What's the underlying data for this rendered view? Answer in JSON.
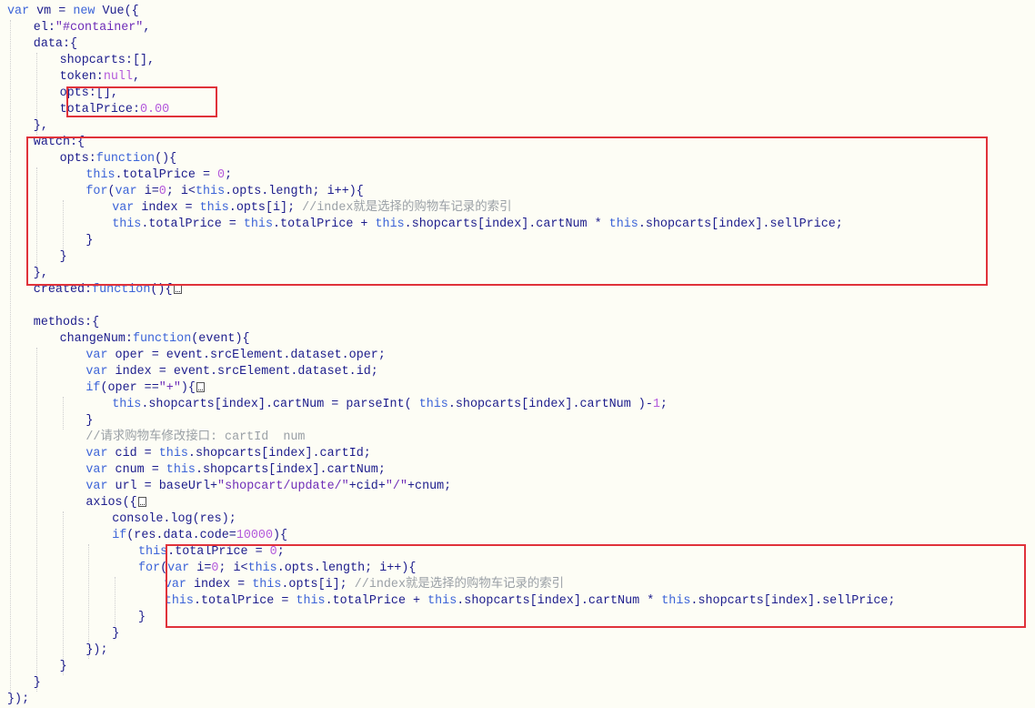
{
  "editor": {
    "lines": [
      [
        [
          "var",
          "kw"
        ],
        [
          " vm = ",
          ""
        ],
        [
          "new",
          "kw"
        ],
        [
          " Vue({",
          ""
        ]
      ],
      [
        [
          "el:",
          ""
        ],
        [
          "\"#container\"",
          "str"
        ],
        [
          ",",
          ""
        ]
      ],
      [
        [
          "data:{",
          ""
        ]
      ],
      [
        [
          "shopcarts:[],",
          ""
        ]
      ],
      [
        [
          "token:",
          ""
        ],
        [
          "null",
          "lit"
        ],
        [
          ",",
          ""
        ]
      ],
      [
        [
          "opts:[],",
          ""
        ]
      ],
      [
        [
          "totalPrice:",
          ""
        ],
        [
          "0.00",
          "lit"
        ]
      ],
      [
        [
          "},",
          ""
        ]
      ],
      [
        [
          "watch:{",
          ""
        ]
      ],
      [
        [
          "opts:",
          ""
        ],
        [
          "function",
          "kw"
        ],
        [
          "(){",
          ""
        ]
      ],
      [
        [
          "this",
          "kw"
        ],
        [
          ".totalPrice = ",
          ""
        ],
        [
          "0",
          "lit"
        ],
        [
          ";",
          ""
        ]
      ],
      [
        [
          "for",
          "kw"
        ],
        [
          "(",
          ""
        ],
        [
          "var",
          "kw"
        ],
        [
          " i=",
          ""
        ],
        [
          "0",
          "lit"
        ],
        [
          "; i<",
          ""
        ],
        [
          "this",
          "kw"
        ],
        [
          ".opts.length; i++){",
          ""
        ]
      ],
      [
        [
          "var",
          "kw"
        ],
        [
          " index = ",
          ""
        ],
        [
          "this",
          "kw"
        ],
        [
          ".opts[i]; ",
          ""
        ],
        [
          "//index就是选择的购物车记录的索引",
          "cm"
        ]
      ],
      [
        [
          "this",
          "kw"
        ],
        [
          ".totalPrice = ",
          ""
        ],
        [
          "this",
          "kw"
        ],
        [
          ".totalPrice + ",
          ""
        ],
        [
          "this",
          "kw"
        ],
        [
          ".shopcarts[index].cartNum * ",
          ""
        ],
        [
          "this",
          "kw"
        ],
        [
          ".shopcarts[index].sellPrice;",
          ""
        ]
      ],
      [
        [
          "}",
          ""
        ]
      ],
      [
        [
          "}",
          ""
        ]
      ],
      [
        [
          "},",
          ""
        ]
      ],
      [
        [
          "created:",
          ""
        ],
        [
          "function",
          "kw"
        ],
        [
          "(){",
          ""
        ],
        [
          "",
          "fold"
        ]
      ],
      [],
      [
        [
          "methods:{",
          ""
        ]
      ],
      [
        [
          "changeNum:",
          ""
        ],
        [
          "function",
          "kw"
        ],
        [
          "(event){",
          ""
        ]
      ],
      [
        [
          "var",
          "kw"
        ],
        [
          " oper = event.srcElement.dataset.oper;",
          ""
        ]
      ],
      [
        [
          "var",
          "kw"
        ],
        [
          " index = event.srcElement.dataset.id;",
          ""
        ]
      ],
      [
        [
          "if",
          "kw"
        ],
        [
          "(oper ==",
          ""
        ],
        [
          "\"+\"",
          "str"
        ],
        [
          "){",
          ""
        ],
        [
          "",
          "fold"
        ]
      ],
      [
        [
          "this",
          "kw"
        ],
        [
          ".shopcarts[index].cartNum = parseInt( ",
          ""
        ],
        [
          "this",
          "kw"
        ],
        [
          ".shopcarts[index].cartNum )-",
          ""
        ],
        [
          "1",
          "lit"
        ],
        [
          ";",
          ""
        ]
      ],
      [
        [
          "}",
          ""
        ]
      ],
      [
        [
          "//请求购物车修改接口: cartId  num",
          "cm"
        ]
      ],
      [
        [
          "var",
          "kw"
        ],
        [
          " cid = ",
          ""
        ],
        [
          "this",
          "kw"
        ],
        [
          ".shopcarts[index].cartId;",
          ""
        ]
      ],
      [
        [
          "var",
          "kw"
        ],
        [
          " cnum = ",
          ""
        ],
        [
          "this",
          "kw"
        ],
        [
          ".shopcarts[index].cartNum;",
          ""
        ]
      ],
      [
        [
          "var",
          "kw"
        ],
        [
          " url = baseUrl+",
          ""
        ],
        [
          "\"shopcart/update/\"",
          "str"
        ],
        [
          "+cid+",
          ""
        ],
        [
          "\"/\"",
          "str"
        ],
        [
          "+cnum;",
          ""
        ]
      ],
      [
        [
          "axios({",
          ""
        ],
        [
          "",
          "fold"
        ]
      ],
      [
        [
          "console.log(res);",
          ""
        ]
      ],
      [
        [
          "if",
          "kw"
        ],
        [
          "(res.data.code=",
          ""
        ],
        [
          "10000",
          "lit"
        ],
        [
          "){",
          ""
        ]
      ],
      [
        [
          "this",
          "kw"
        ],
        [
          ".totalPrice = ",
          ""
        ],
        [
          "0",
          "lit"
        ],
        [
          ";",
          ""
        ]
      ],
      [
        [
          "for",
          "kw"
        ],
        [
          "(",
          ""
        ],
        [
          "var",
          "kw"
        ],
        [
          " i=",
          ""
        ],
        [
          "0",
          "lit"
        ],
        [
          "; i<",
          ""
        ],
        [
          "this",
          "kw"
        ],
        [
          ".opts.length; i++){",
          ""
        ]
      ],
      [
        [
          "var",
          "kw"
        ],
        [
          " index = ",
          ""
        ],
        [
          "this",
          "kw"
        ],
        [
          ".opts[i]; ",
          ""
        ],
        [
          "//index就是选择的购物车记录的索引",
          "cm"
        ]
      ],
      [
        [
          "this",
          "kw"
        ],
        [
          ".totalPrice = ",
          ""
        ],
        [
          "this",
          "kw"
        ],
        [
          ".totalPrice + ",
          ""
        ],
        [
          "this",
          "kw"
        ],
        [
          ".shopcarts[index].cartNum * ",
          ""
        ],
        [
          "this",
          "kw"
        ],
        [
          ".shopcarts[index].sellPrice;",
          ""
        ]
      ],
      [
        [
          "}",
          ""
        ]
      ],
      [
        [
          "}",
          ""
        ]
      ],
      [
        [
          "});",
          ""
        ]
      ],
      [
        [
          "}",
          ""
        ]
      ],
      [
        [
          "}",
          ""
        ]
      ],
      [
        [
          "});",
          ""
        ]
      ]
    ]
  },
  "highlight_color": "#e0323a",
  "syntax_colors": {
    "identifier": "#1c1c8c",
    "keyword": "#3c64d8",
    "string": "#6e2cb8",
    "literal": "#b45adc",
    "comment": "#9aa0a6"
  }
}
